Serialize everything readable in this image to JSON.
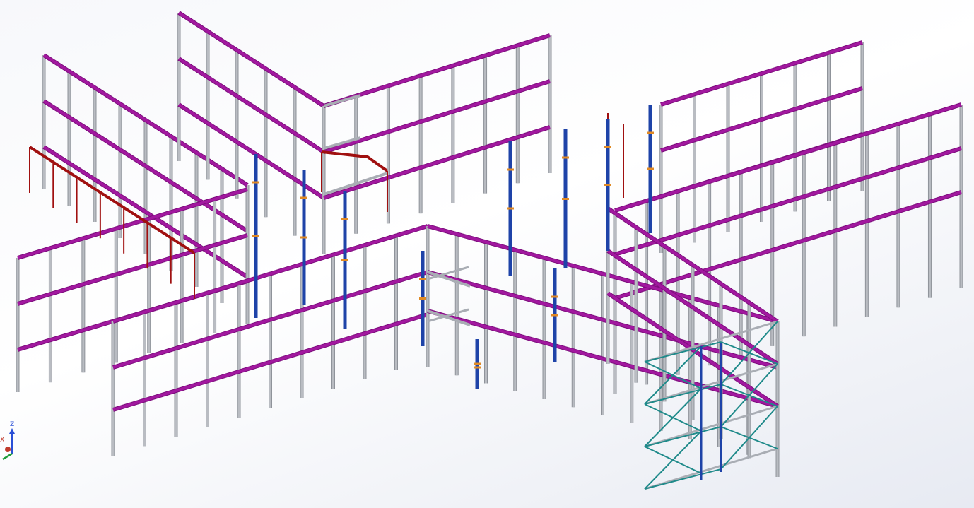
{
  "viewport": {
    "type": "cad-3d-structure-view",
    "background_top": "#f7f8fb",
    "background_bottom": "#e7eaf2"
  },
  "colors": {
    "column": "#b9bcc2",
    "column_edge": "#8f939a",
    "beam_primary": "#a2189f",
    "beam_secondary": "#7d0f7d",
    "beam_gray": "#a9adb4",
    "pipe_red": "#a01010",
    "blue_member": "#1e43a8",
    "bracing": "#1f8a8a",
    "connector": "#e08a25"
  },
  "triad": {
    "z_label": "Z",
    "x_label": "X",
    "z_color": "#2a4fd6",
    "x_color": "#c0392b",
    "y_color": "#1e9c3a"
  }
}
